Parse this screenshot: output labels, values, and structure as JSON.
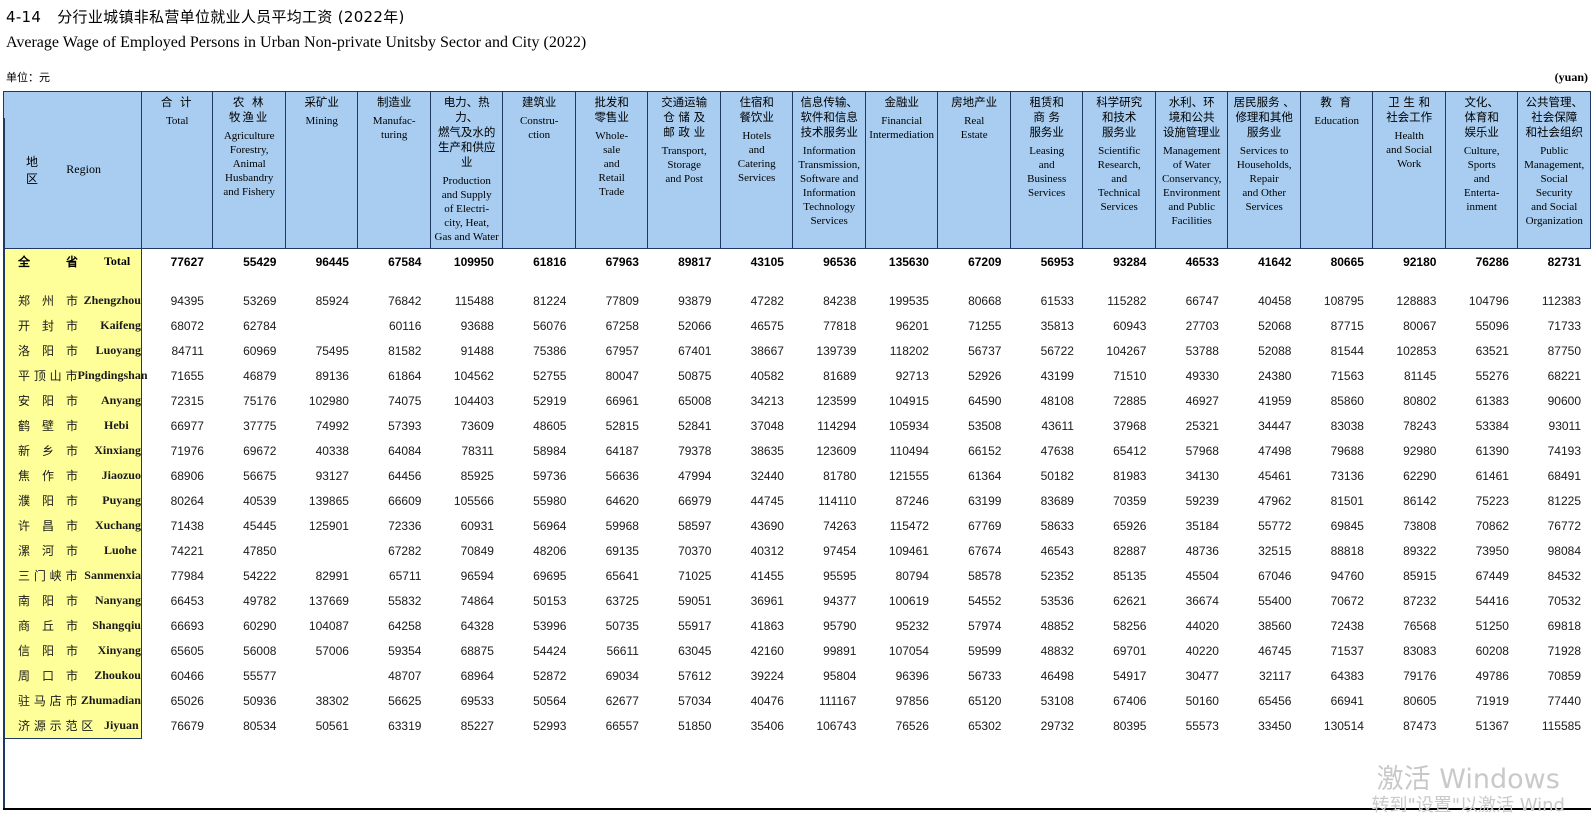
{
  "document": {
    "table_number": "4-14",
    "title_cn": "分行业城镇非私营单位就业人员平均工资 (2022年)",
    "title_en": "Average Wage of Employed Persons in Urban Non-private Unitsby Sector and City (2022)",
    "unit_cn": "单位：元",
    "unit_en": "(yuan)"
  },
  "header": {
    "region_cn": "地 区",
    "region_en": "Region",
    "columns": [
      {
        "cn": "合 计",
        "en": "Total"
      },
      {
        "cn": "农 林\n牧渔业",
        "en": "Agriculture\nForestry,\nAnimal\nHusbandry\nand Fishery"
      },
      {
        "cn": "采矿业",
        "en": "Mining"
      },
      {
        "cn": "制造业",
        "en": "Manufac-\nturing"
      },
      {
        "cn": "电力、热力、\n燃气及水的\n生产和供应业",
        "en": "Production\nand Supply\nof Electri-\ncity, Heat,\nGas and Water"
      },
      {
        "cn": "建筑业",
        "en": "Constru-\nction"
      },
      {
        "cn": "批发和\n零售业",
        "en": "Whole-\nsale\nand\nRetail\nTrade"
      },
      {
        "cn": "交通运输\n仓 储 及\n邮 政 业",
        "en": "Transport,\nStorage\nand Post"
      },
      {
        "cn": "住宿和\n餐饮业",
        "en": "Hotels\nand\nCatering\nServices"
      },
      {
        "cn": "信息传输、\n软件和信息\n技术服务业",
        "en": "Information\nTransmission,\nSoftware and\nInformation\nTechnology\nServices"
      },
      {
        "cn": "金融业",
        "en": "Financial\nIntermediation"
      },
      {
        "cn": "房地产业",
        "en": "Real\nEstate"
      },
      {
        "cn": "租赁和\n商 务\n服务业",
        "en": "Leasing\nand\nBusiness\nServices"
      },
      {
        "cn": "科学研究\n和技术\n服务业",
        "en": "Scientific\nResearch,\nand\nTechnical\nServices"
      },
      {
        "cn": "水利、环\n境和公共\n设施管理业",
        "en": "Management\nof Water\nConservancy,\nEnvironment\nand Public\nFacilities"
      },
      {
        "cn": "居民服务 、\n修理和其他\n服务业",
        "en": "Services to\nHouseholds,\nRepair\nand Other\nServices"
      },
      {
        "cn": "教 育",
        "en": "Education"
      },
      {
        "cn": "卫 生 和\n社会工作",
        "en": "Health\nand Social\nWork"
      },
      {
        "cn": "文化、\n体育和\n娱乐业",
        "en": "Culture,\nSports\nand\nEnterta-\ninment"
      },
      {
        "cn": "公共管理、\n社会保障\n和社会组织",
        "en": "Public\nManagement,\nSocial\nSecurity\nand Social\nOrganization"
      }
    ]
  },
  "rows": [
    {
      "region_cn": "全　　　省",
      "region_en": "Total",
      "is_total": true,
      "values": [
        "77627",
        "55429",
        "96445",
        "67584",
        "109950",
        "61816",
        "67963",
        "89817",
        "43105",
        "96536",
        "135630",
        "67209",
        "56953",
        "93284",
        "46533",
        "41642",
        "80665",
        "92180",
        "76286",
        "82731"
      ]
    },
    {
      "region_cn": "郑　州　市",
      "region_en": "Zhengzhou",
      "is_total": false,
      "values": [
        "94395",
        "53269",
        "85924",
        "76842",
        "115488",
        "81224",
        "77809",
        "93879",
        "47282",
        "84238",
        "199535",
        "80668",
        "61533",
        "115282",
        "66747",
        "40458",
        "108795",
        "128883",
        "104796",
        "112383"
      ]
    },
    {
      "region_cn": "开　封　市",
      "region_en": "Kaifeng",
      "is_total": false,
      "values": [
        "68072",
        "62784",
        "",
        "60116",
        "93688",
        "56076",
        "67258",
        "52066",
        "46575",
        "77818",
        "96201",
        "71255",
        "35813",
        "60943",
        "27703",
        "52068",
        "87715",
        "80067",
        "55096",
        "71733"
      ]
    },
    {
      "region_cn": "洛　阳　市",
      "region_en": "Luoyang",
      "is_total": false,
      "values": [
        "84711",
        "60969",
        "75495",
        "81582",
        "91488",
        "75386",
        "67957",
        "67401",
        "38667",
        "139739",
        "118202",
        "56737",
        "56722",
        "104267",
        "53788",
        "52088",
        "81544",
        "102853",
        "63521",
        "87750"
      ]
    },
    {
      "region_cn": "平 顶 山 市",
      "region_en": "Pingdingshan",
      "is_total": false,
      "values": [
        "71655",
        "46879",
        "89136",
        "61864",
        "104562",
        "52755",
        "80047",
        "50875",
        "40582",
        "81689",
        "92713",
        "52926",
        "43199",
        "71510",
        "49330",
        "24380",
        "71563",
        "81145",
        "55276",
        "68221"
      ]
    },
    {
      "region_cn": "安　阳　市",
      "region_en": "Anyang",
      "is_total": false,
      "values": [
        "72315",
        "75176",
        "102980",
        "74075",
        "104403",
        "52919",
        "66961",
        "65008",
        "34213",
        "123599",
        "104915",
        "64590",
        "48108",
        "72885",
        "46927",
        "41959",
        "85860",
        "80802",
        "61383",
        "90600"
      ]
    },
    {
      "region_cn": "鹤　壁　市",
      "region_en": "Hebi",
      "is_total": false,
      "values": [
        "66977",
        "37775",
        "74992",
        "57393",
        "73609",
        "48605",
        "52815",
        "52841",
        "37048",
        "114294",
        "105934",
        "53508",
        "43611",
        "37968",
        "25321",
        "34447",
        "83038",
        "78243",
        "53384",
        "93011"
      ]
    },
    {
      "region_cn": "新　乡　市",
      "region_en": "Xinxiang",
      "is_total": false,
      "values": [
        "71976",
        "69672",
        "40338",
        "64084",
        "78311",
        "58984",
        "64187",
        "79378",
        "38635",
        "123609",
        "110494",
        "66152",
        "47638",
        "65412",
        "57968",
        "47498",
        "79688",
        "92980",
        "61390",
        "74193"
      ]
    },
    {
      "region_cn": "焦　作　市",
      "region_en": "Jiaozuo",
      "is_total": false,
      "values": [
        "68906",
        "56675",
        "93127",
        "64456",
        "85925",
        "59736",
        "56636",
        "47994",
        "32440",
        "81780",
        "121555",
        "61364",
        "50182",
        "81983",
        "34130",
        "45461",
        "73136",
        "62290",
        "61461",
        "68491"
      ]
    },
    {
      "region_cn": "濮　阳　市",
      "region_en": "Puyang",
      "is_total": false,
      "values": [
        "80264",
        "40539",
        "139865",
        "66609",
        "105566",
        "55980",
        "64620",
        "66979",
        "44745",
        "114110",
        "87246",
        "63199",
        "83689",
        "70359",
        "59239",
        "47962",
        "81501",
        "86142",
        "75223",
        "81225"
      ]
    },
    {
      "region_cn": "许　昌　市",
      "region_en": "Xuchang",
      "is_total": false,
      "values": [
        "71438",
        "45445",
        "125901",
        "72336",
        "60931",
        "56964",
        "59968",
        "58597",
        "43690",
        "74263",
        "115472",
        "67769",
        "58633",
        "65926",
        "35184",
        "55772",
        "69845",
        "73808",
        "70862",
        "76772"
      ]
    },
    {
      "region_cn": "漯　河　市",
      "region_en": "Luohe",
      "is_total": false,
      "values": [
        "74221",
        "47850",
        "",
        "67282",
        "70849",
        "48206",
        "69135",
        "70370",
        "40312",
        "97454",
        "109461",
        "67674",
        "46543",
        "82887",
        "48736",
        "32515",
        "88818",
        "89322",
        "73950",
        "98084"
      ]
    },
    {
      "region_cn": "三 门 峡 市",
      "region_en": "Sanmenxia",
      "is_total": false,
      "values": [
        "77984",
        "54222",
        "82991",
        "65711",
        "96594",
        "69695",
        "65641",
        "71025",
        "41455",
        "95595",
        "80794",
        "58578",
        "52352",
        "85135",
        "45504",
        "67046",
        "94760",
        "85915",
        "67449",
        "84532"
      ]
    },
    {
      "region_cn": "南　阳　市",
      "region_en": "Nanyang",
      "is_total": false,
      "values": [
        "66453",
        "49782",
        "137669",
        "55832",
        "74864",
        "50153",
        "63725",
        "59051",
        "36961",
        "94377",
        "100619",
        "54552",
        "53536",
        "62621",
        "36674",
        "55400",
        "70672",
        "87232",
        "54416",
        "70532"
      ]
    },
    {
      "region_cn": "商　丘　市",
      "region_en": "Shangqiu",
      "is_total": false,
      "values": [
        "66693",
        "60290",
        "104087",
        "64258",
        "64328",
        "53996",
        "50735",
        "55917",
        "41863",
        "95790",
        "95232",
        "57974",
        "48852",
        "58256",
        "44020",
        "38560",
        "72438",
        "76568",
        "51250",
        "69818"
      ]
    },
    {
      "region_cn": "信　阳　市",
      "region_en": "Xinyang",
      "is_total": false,
      "values": [
        "65605",
        "56008",
        "57006",
        "59354",
        "68875",
        "54424",
        "56611",
        "63045",
        "42160",
        "99891",
        "107054",
        "59599",
        "48832",
        "69701",
        "40220",
        "46745",
        "71537",
        "83083",
        "60208",
        "71928"
      ]
    },
    {
      "region_cn": "周　口　市",
      "region_en": "Zhoukou",
      "is_total": false,
      "values": [
        "60466",
        "55577",
        "",
        "48707",
        "68964",
        "52872",
        "69034",
        "57612",
        "39224",
        "95804",
        "96396",
        "56733",
        "46498",
        "54917",
        "30477",
        "32117",
        "64383",
        "79176",
        "49786",
        "70859"
      ]
    },
    {
      "region_cn": "驻 马 店 市",
      "region_en": "Zhumadian",
      "is_total": false,
      "values": [
        "65026",
        "50936",
        "38302",
        "56625",
        "69533",
        "50564",
        "62677",
        "57034",
        "40476",
        "111167",
        "97856",
        "65120",
        "53108",
        "67406",
        "50160",
        "65456",
        "66941",
        "80605",
        "71919",
        "77440"
      ]
    },
    {
      "region_cn": "济 源 示 范 区",
      "region_en": "Jiyuan",
      "is_total": false,
      "values": [
        "76679",
        "80534",
        "50561",
        "63319",
        "85227",
        "52993",
        "66557",
        "51850",
        "35406",
        "106743",
        "76526",
        "65302",
        "29732",
        "80395",
        "55573",
        "33450",
        "130514",
        "87473",
        "51367",
        "115585"
      ]
    }
  ],
  "watermark": {
    "line1": "激活 Windows",
    "line2": "转到\"设置\"以激活 Wind"
  }
}
